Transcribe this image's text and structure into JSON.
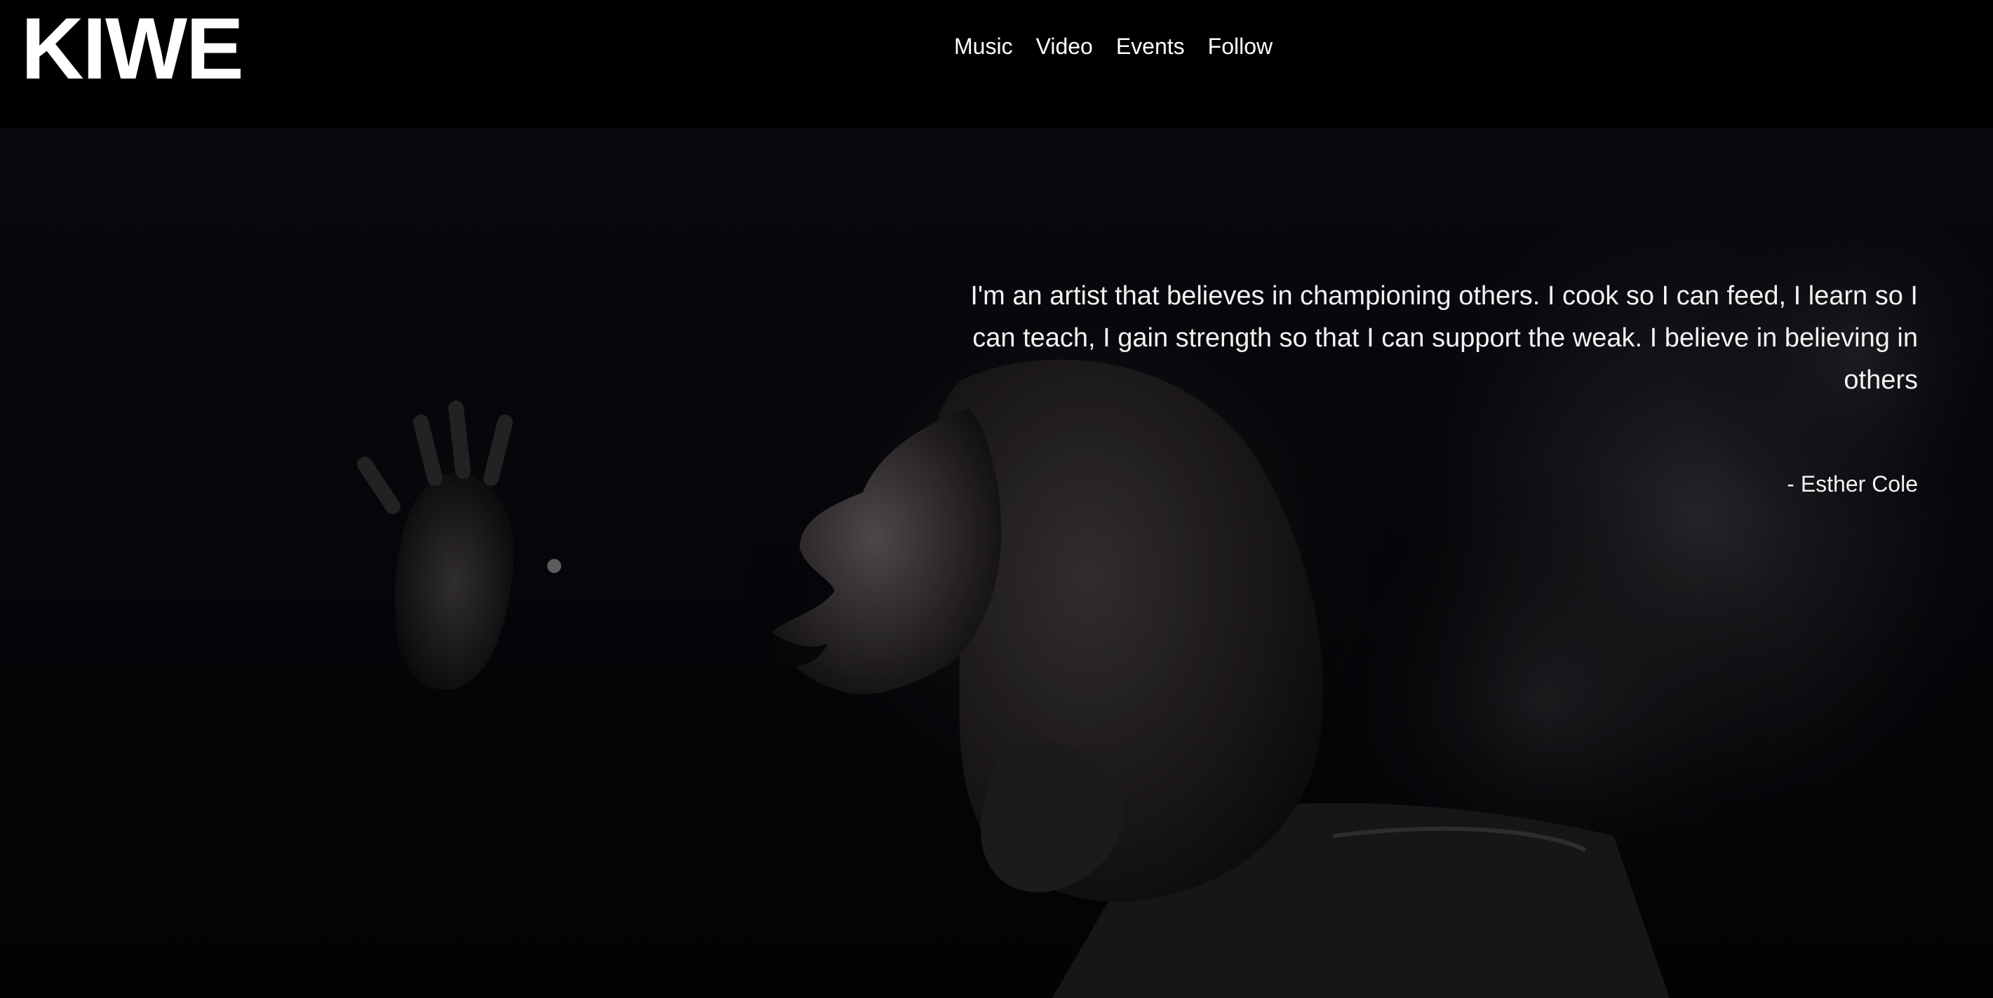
{
  "brand": {
    "logo_text": "KIWE"
  },
  "nav": {
    "items": [
      {
        "label": "Music"
      },
      {
        "label": "Video"
      },
      {
        "label": "Events"
      },
      {
        "label": "Follow"
      }
    ]
  },
  "hero": {
    "image": "singer-photo",
    "quote": "I'm an artist that believes in championing others. I cook so I can feed, I learn so I can teach, I gain strength so that I can support the weak. I believe in believing in others",
    "attribution": "- Esther Cole"
  },
  "colors": {
    "background": "#000000",
    "text": "#ffffff"
  }
}
